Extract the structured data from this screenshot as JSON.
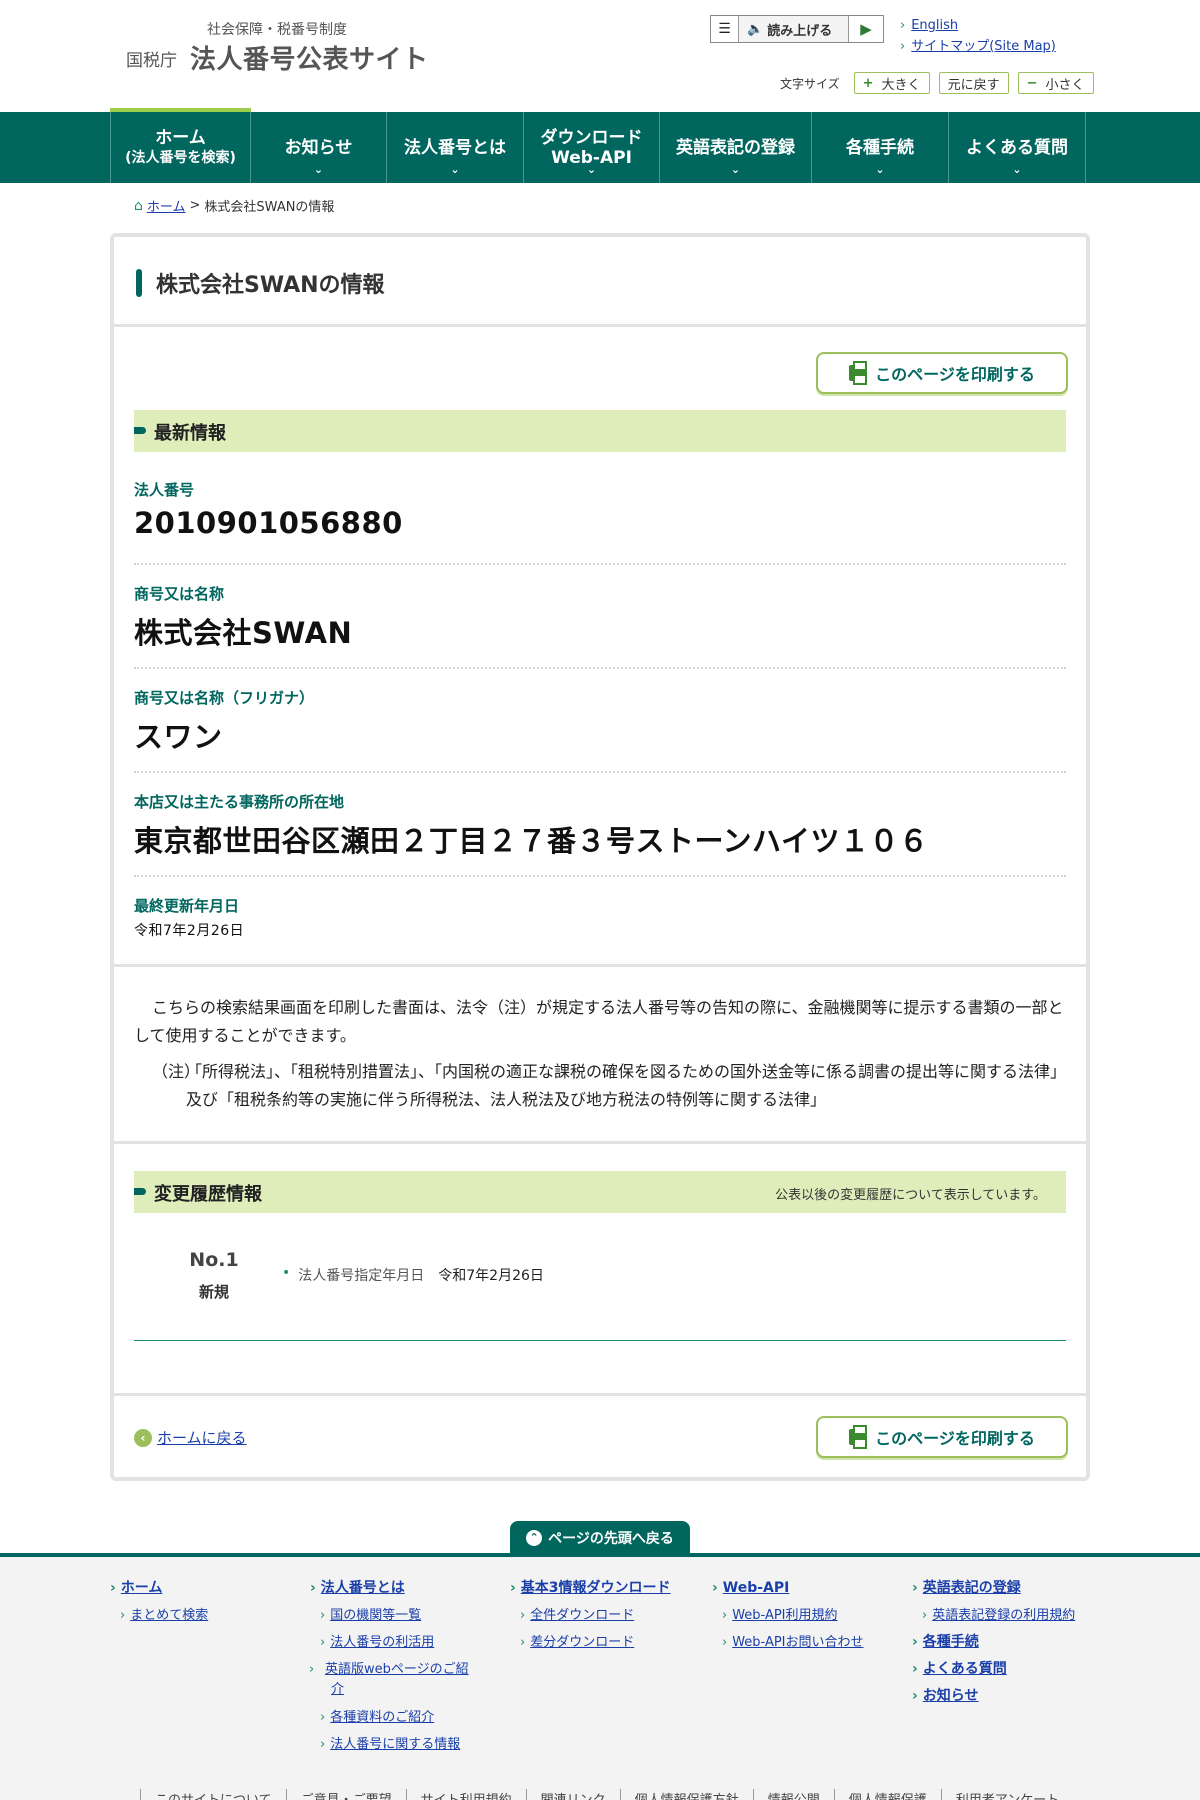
{
  "header": {
    "logo_sub": "社会保障・税番号制度",
    "logo_agency": "国税庁",
    "logo_title": "法人番号公表サイト",
    "read_aloud_label": "読み上げる",
    "lang_links": [
      "English",
      "サイトマップ(Site Map)"
    ],
    "font_size_label": "文字サイズ",
    "font_size_buttons": [
      {
        "symbol": "+",
        "label": "大きく"
      },
      {
        "symbol": "",
        "label": "元に戻す"
      },
      {
        "symbol": "−",
        "label": "小さく"
      }
    ]
  },
  "nav": {
    "items": [
      {
        "label": "ホーム",
        "sub": "(法人番号を検索)"
      },
      {
        "label": "お知らせ",
        "sub": ""
      },
      {
        "label": "法人番号とは",
        "sub": ""
      },
      {
        "label": "ダウンロード",
        "sub": "Web-API"
      },
      {
        "label": "英語表記の登録",
        "sub": ""
      },
      {
        "label": "各種手続",
        "sub": ""
      },
      {
        "label": "よくある質問",
        "sub": ""
      }
    ],
    "chevron": "⌄"
  },
  "breadcrumb": {
    "home": "ホーム",
    "separator": ">",
    "current": "株式会社SWANの情報"
  },
  "page": {
    "title": "株式会社SWANの情報",
    "print_label": "このページを印刷する",
    "latest_section": "最新情報",
    "fields": {
      "corp_number_label": "法人番号",
      "corp_number": "2010901056880",
      "name_label": "商号又は名称",
      "name": "株式会社SWAN",
      "kana_label": "商号又は名称（フリガナ）",
      "kana": "スワン",
      "address_label": "本店又は主たる事務所の所在地",
      "address": "東京都世田谷区瀬田２丁目２７番３号ストーンハイツ１０６",
      "updated_label": "最終更新年月日",
      "updated": "令和7年2月26日"
    },
    "notice": {
      "p1": "こちらの検索結果画面を印刷した書面は、法令（注）が規定する法人番号等の告知の際に、金融機関等に提示する書類の一部として使用することができます。",
      "note_mark": "（注）",
      "note": "「所得税法」、「租税特別措置法」、「内国税の適正な課税の確保を図るための国外送金等に係る調書の提出等に関する法律」及び「租税条約等の実施に伴う所得税法、法人税法及び地方税法の特例等に関する法律」"
    },
    "history": {
      "section": "変更履歴情報",
      "note": "公表以後の変更履歴について表示しています。",
      "entries": [
        {
          "no": "No.1",
          "kind": "新規",
          "item_label": "法人番号指定年月日",
          "item_value": "令和7年2月26日"
        }
      ]
    },
    "back_home": "ホームに戻る"
  },
  "pagetop": "ページの先頭へ戻る",
  "footer": {
    "columns": [
      {
        "main": [
          {
            "label": "ホーム",
            "subs": [
              "まとめて検索"
            ]
          }
        ]
      },
      {
        "main": [
          {
            "label": "法人番号とは",
            "subs": [
              "国の機関等一覧",
              "法人番号の利活用",
              "英語版webページのご紹介",
              "各種資料のご紹介",
              "法人番号に関する情報"
            ]
          }
        ]
      },
      {
        "main": [
          {
            "label": "基本3情報ダウンロード",
            "subs": [
              "全件ダウンロード",
              "差分ダウンロード"
            ]
          }
        ]
      },
      {
        "main": [
          {
            "label": "Web-API",
            "subs": [
              "Web-API利用規約",
              "Web-APIお問い合わせ"
            ]
          }
        ]
      },
      {
        "main": [
          {
            "label": "英語表記の登録",
            "subs": [
              "英語表記登録の利用規約"
            ]
          },
          {
            "label": "各種手続",
            "subs": []
          },
          {
            "label": "よくある質問",
            "subs": []
          },
          {
            "label": "お知らせ",
            "subs": []
          }
        ]
      }
    ],
    "bottom_links": [
      "このサイトについて",
      "ご意見・ご要望",
      "サイト利用規約",
      "関連リンク",
      "個人情報保護方針",
      "情報公開",
      "個人情報保護",
      "利用者アンケート"
    ]
  }
}
